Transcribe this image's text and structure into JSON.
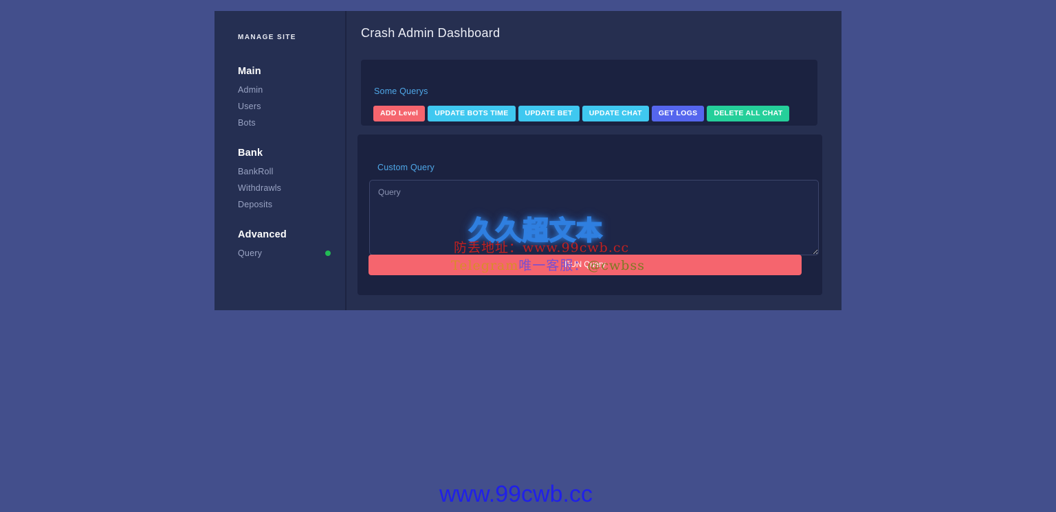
{
  "sidebar": {
    "brand": "MANAGE SITE",
    "groups": [
      {
        "title": "Main",
        "items": [
          {
            "label": "Admin",
            "dot": false
          },
          {
            "label": "Users",
            "dot": false
          },
          {
            "label": "Bots",
            "dot": false
          }
        ]
      },
      {
        "title": "Bank",
        "items": [
          {
            "label": "BankRoll",
            "dot": false
          },
          {
            "label": "Withdrawls",
            "dot": false
          },
          {
            "label": "Deposits",
            "dot": false
          }
        ]
      },
      {
        "title": "Advanced",
        "items": [
          {
            "label": "Query",
            "dot": true
          }
        ]
      }
    ],
    "status_dot_color": "#22bb55"
  },
  "main": {
    "page_title": "Crash Admin Dashboard",
    "queries_card": {
      "heading": "Some Querys",
      "buttons": [
        {
          "label": "ADD Level",
          "color": "#f5656e"
        },
        {
          "label": "UPDATE BOTS TIME",
          "color": "#3fc8f0"
        },
        {
          "label": "UPDATE BET",
          "color": "#3fc8f0"
        },
        {
          "label": "UPDATE CHAT",
          "color": "#3fc8f0"
        },
        {
          "label": "GET LOGS",
          "color": "#5566ee"
        },
        {
          "label": "DELETE ALL CHAT",
          "color": "#25cf9a"
        }
      ]
    },
    "custom_card": {
      "heading": "Custom Query",
      "textarea_placeholder": "Query",
      "textarea_value": "",
      "run_button_label": "RUN Query",
      "run_button_color": "#f5656e"
    }
  },
  "watermarks": {
    "title": "久久超文本",
    "line2": "防丢地址：www.99cwb.cc",
    "line3_part1": "Telegram",
    "line3_part2": "唯一客服：",
    "line3_part3": "@cwbss",
    "bottom": "www.99cwb.cc"
  },
  "theme": {
    "page_background": "#434f8c",
    "sidebar_background": "#252f52",
    "main_background": "#262f50",
    "card_background": "#1b2240",
    "heading_accent": "#4fa8e8"
  }
}
